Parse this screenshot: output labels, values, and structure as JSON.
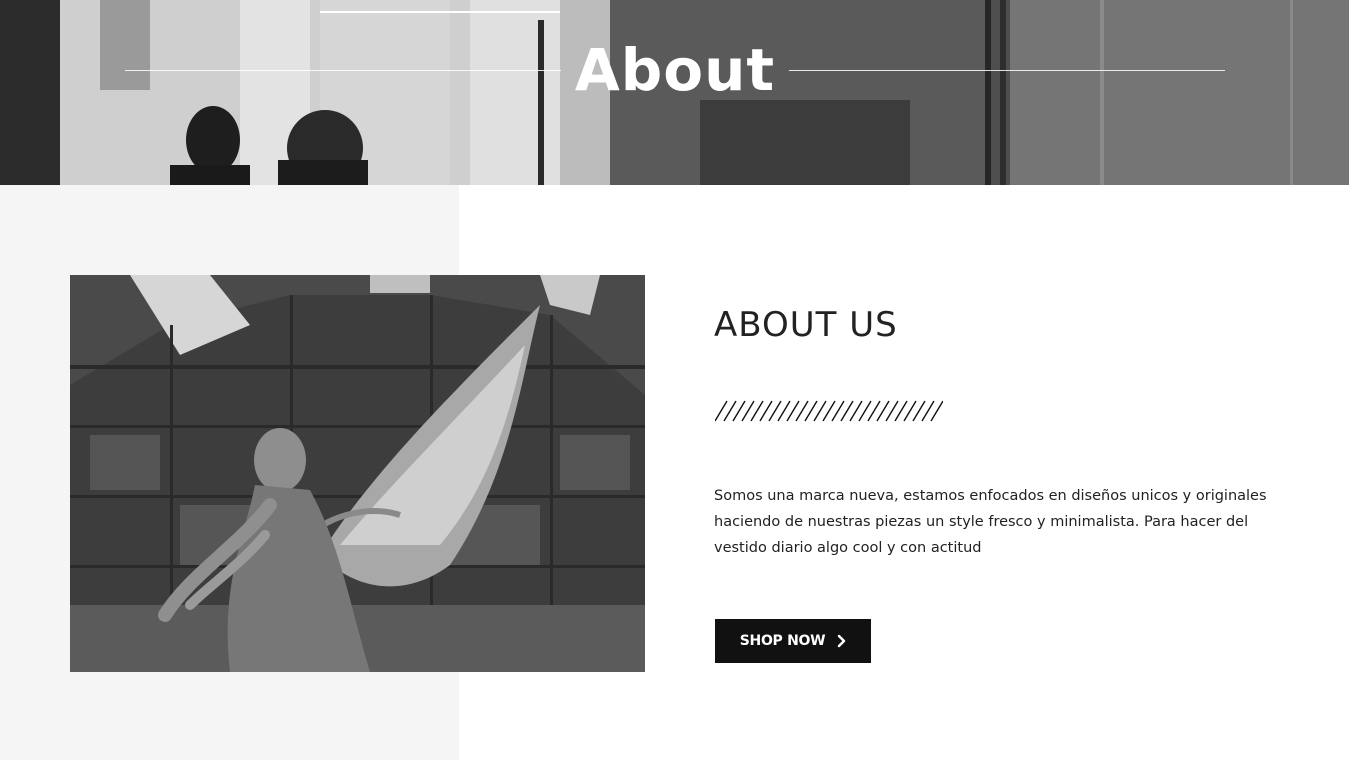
{
  "hero": {
    "title": "About"
  },
  "about": {
    "heading": "ABOUT US",
    "description": "Somos una marca nueva, estamos enfocados en diseños unicos y originales haciendo de nuestras piezas un style fresco y minimalista. Para hacer del vestido diario algo cool y con actitud",
    "button_label": "SHOP NOW",
    "button_icon": "chevron-right-icon",
    "image_icon": "angel-statue-photo"
  },
  "colors": {
    "button_bg": "#111111",
    "button_text": "#ffffff",
    "heading": "#222222",
    "side_panel": "#f5f5f5"
  }
}
